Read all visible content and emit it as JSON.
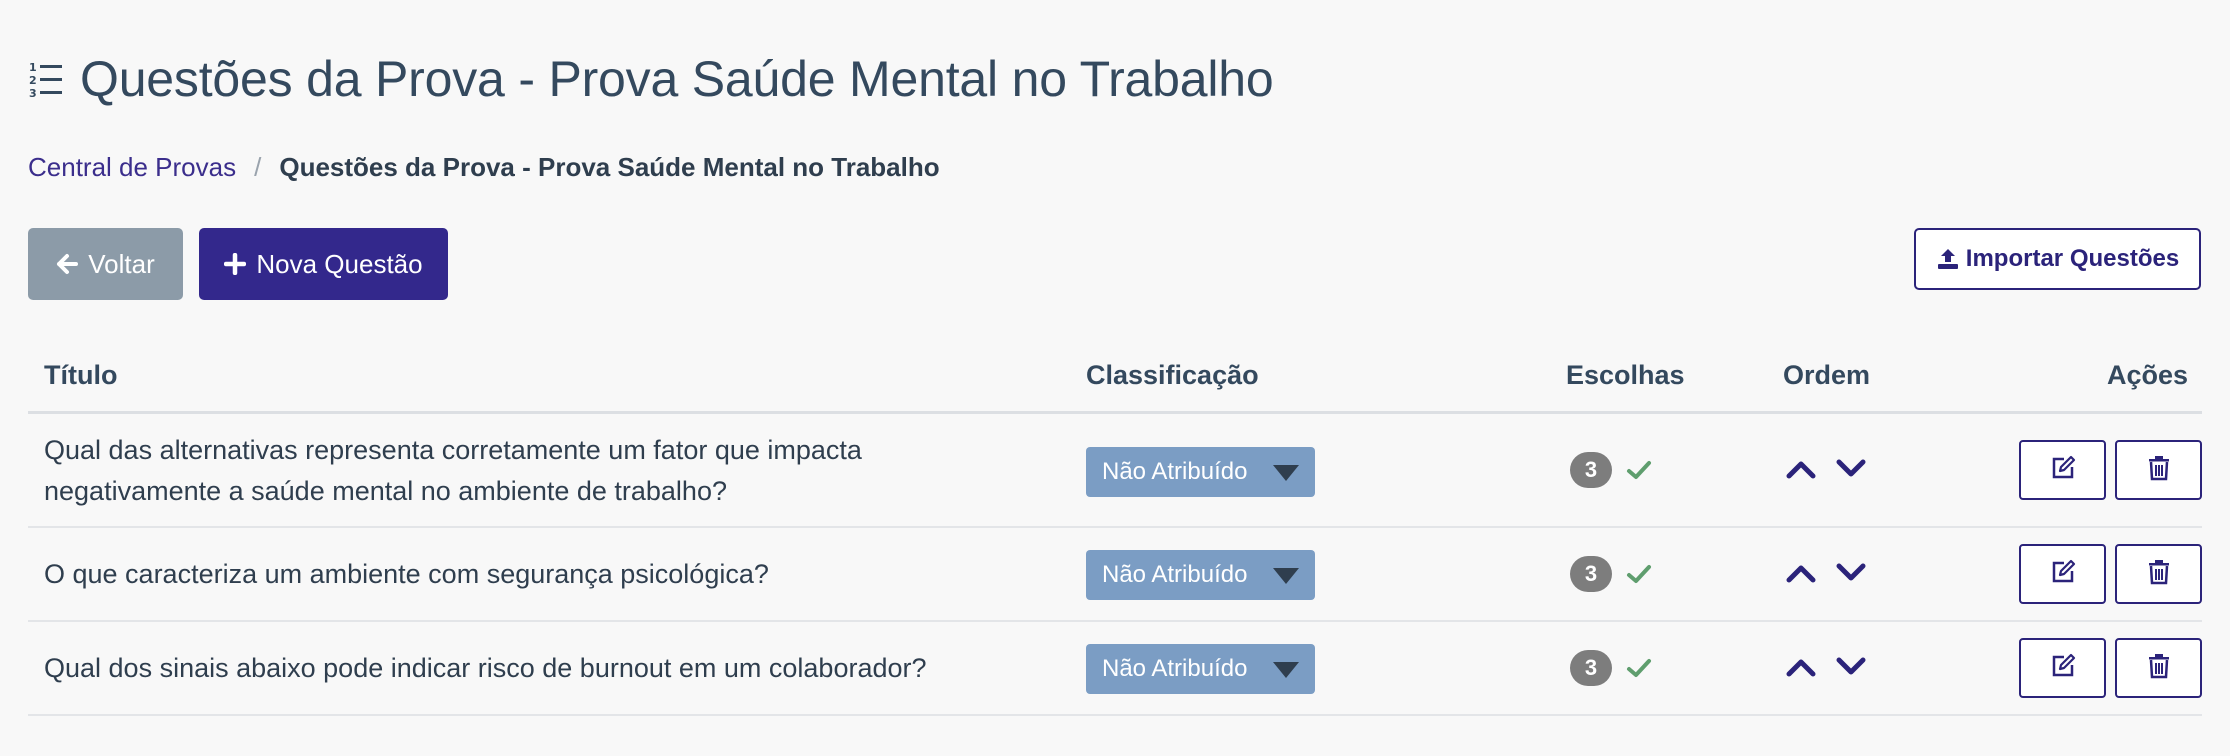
{
  "header": {
    "title": "Questões da Prova - Prova Saúde Mental no Trabalho",
    "icon": "list-ordered-icon"
  },
  "breadcrumb": {
    "root": "Central de Provas",
    "separator": "/",
    "current": "Questões da Prova - Prova Saúde Mental no Trabalho"
  },
  "toolbar": {
    "back_label": "Voltar",
    "new_label": "Nova Questão",
    "import_label": "Importar Questões"
  },
  "table": {
    "columns": {
      "title": "Título",
      "classification": "Classificação",
      "choices": "Escolhas",
      "order": "Ordem",
      "actions": "Ações"
    },
    "rows": [
      {
        "title": "Qual das alternativas representa corretamente um fator que impacta negativamente a saúde mental no ambiente de trabalho?",
        "classification": "Não Atribuído",
        "choices_count": "3",
        "choices_valid": true
      },
      {
        "title": "O que caracteriza um ambiente com segurança psicológica?",
        "classification": "Não Atribuído",
        "choices_count": "3",
        "choices_valid": true
      },
      {
        "title": "Qual dos sinais abaixo pode indicar risco de burnout em um colaborador?",
        "classification": "Não Atribuído",
        "choices_count": "3",
        "choices_valid": true
      }
    ]
  },
  "colors": {
    "primary": "#33288c",
    "secondary": "#8c9ba8",
    "select_bg": "#7b9dc4",
    "badge": "#7d7d7d",
    "check": "#5f9e6e",
    "text": "#34495e"
  }
}
